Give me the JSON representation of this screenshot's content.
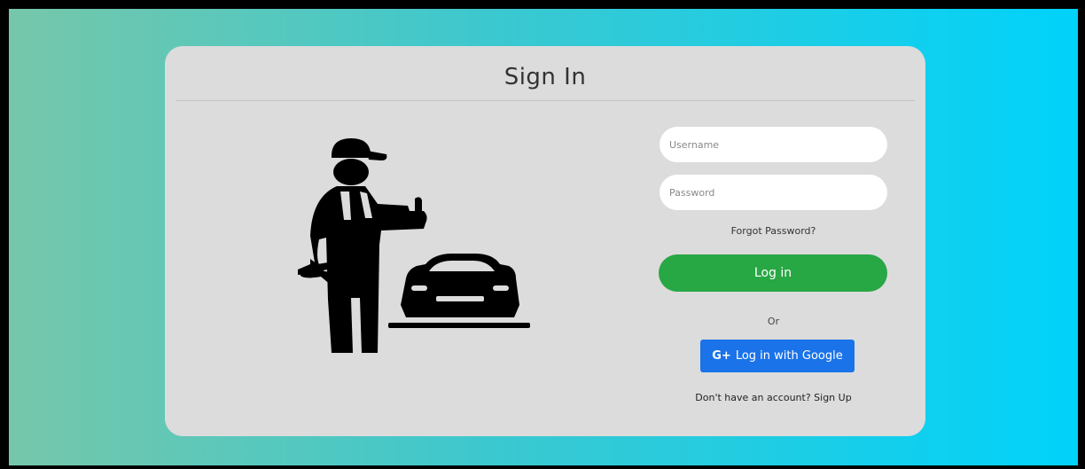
{
  "signin": {
    "title": "Sign In",
    "username_placeholder": "Username",
    "password_placeholder": "Password",
    "forgot_password": "Forgot Password?",
    "login_label": "Log in",
    "or_label": "Or",
    "google_icon": "G+",
    "google_label": "Log in with Google",
    "signup_text": "Don't have an account? Sign Up"
  },
  "colors": {
    "background_gradient_start": "#76c7a9",
    "background_gradient_end": "#00d2fa",
    "card": "#dcdcdc",
    "login_button": "#28a745",
    "google_button": "#1a73e8"
  }
}
